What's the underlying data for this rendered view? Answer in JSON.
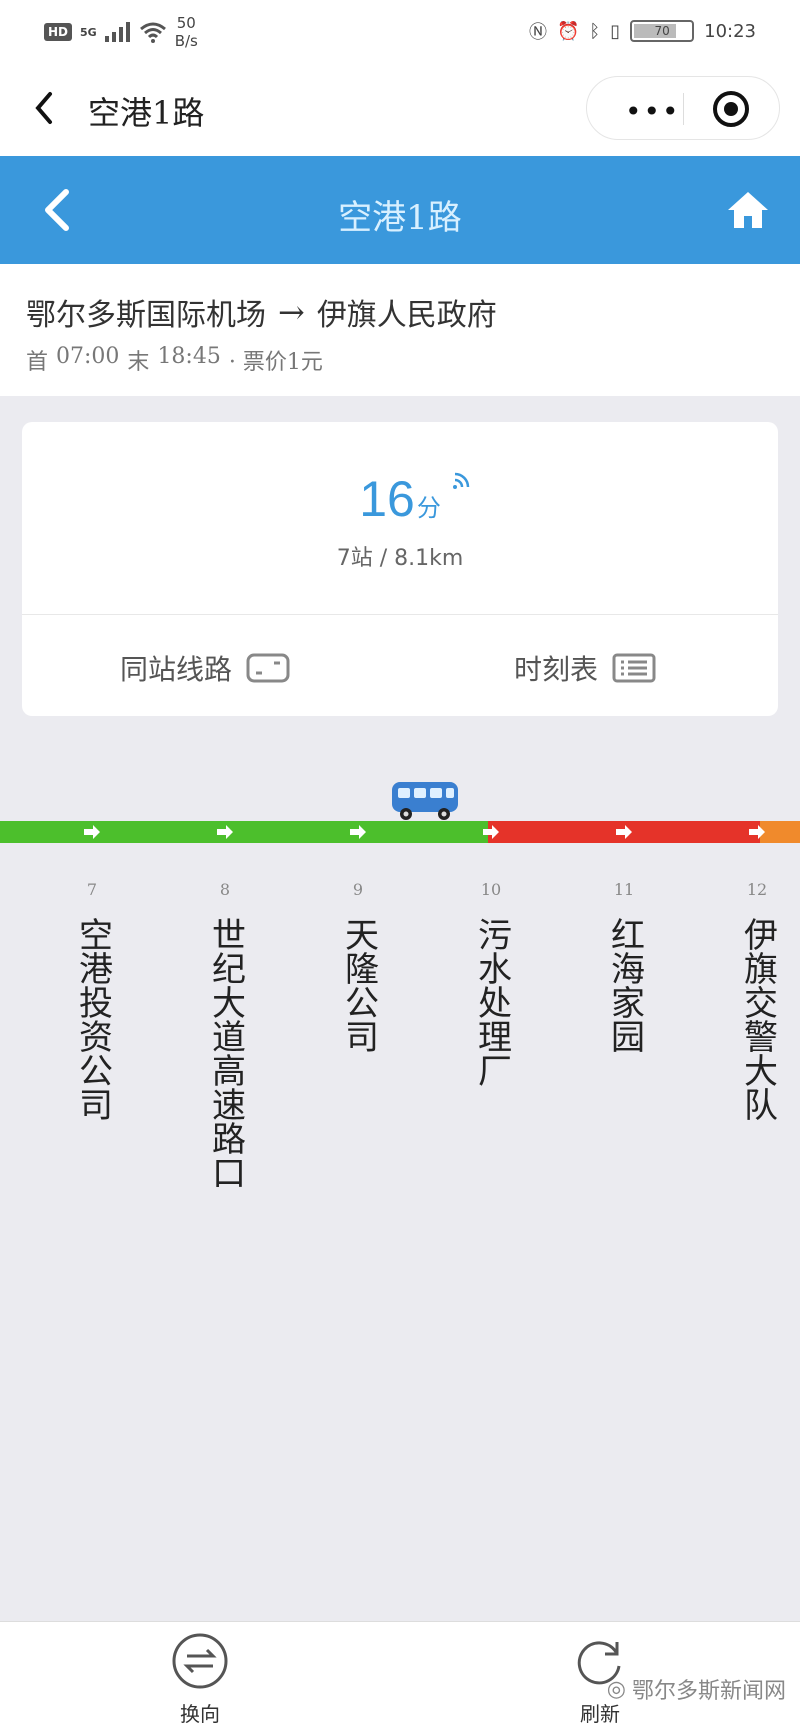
{
  "status_bar": {
    "hd": "HD",
    "network": "5G",
    "speed_value": "50",
    "speed_unit": "B/s",
    "battery": "70",
    "time": "10:23"
  },
  "wechat": {
    "title": "空港1路",
    "more": "•••"
  },
  "header": {
    "title": "空港1路"
  },
  "route": {
    "from": "鄂尔多斯国际机场",
    "arrow": "→",
    "to": "伊旗人民政府",
    "first_label": "首",
    "first_time": "07:00",
    "last_label": "末",
    "last_time": "18:45",
    "fare": "· 票价1元"
  },
  "eta": {
    "minutes": "16",
    "unit": "分",
    "stops": "7站",
    "sep": "/",
    "distance": "8.1km"
  },
  "card_buttons": {
    "same_station": "同站线路",
    "timetable": "时刻表"
  },
  "line": {
    "colors": {
      "green": "#4cbf2c",
      "red": "#e53329",
      "orange": "#f08a2c",
      "bus": "#3a7fd0"
    },
    "segments": [
      "green",
      "green",
      "green",
      "green",
      "red",
      "red",
      "orange"
    ]
  },
  "stops": [
    {
      "no": "7",
      "name": "空港投资公司"
    },
    {
      "no": "8",
      "name": "世纪大道高速路口"
    },
    {
      "no": "9",
      "name": "天隆公司"
    },
    {
      "no": "10",
      "name": "污水处理厂"
    },
    {
      "no": "11",
      "name": "红海家园"
    },
    {
      "no": "12",
      "name": "伊旗交警大队"
    }
  ],
  "bottom": {
    "switch_label": "换向",
    "refresh_label": "刷新",
    "watermark": "鄂尔多斯新闻网"
  }
}
